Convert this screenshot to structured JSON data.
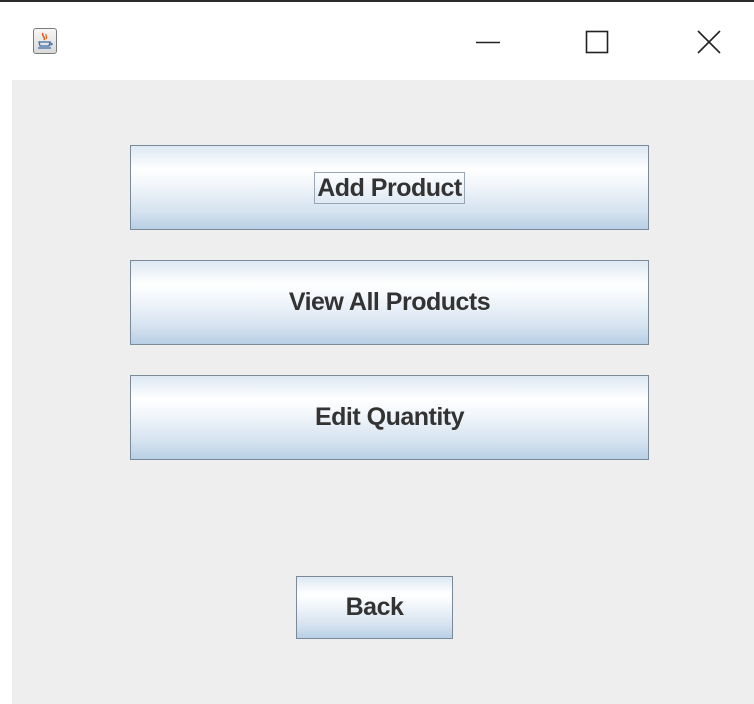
{
  "window": {
    "icon": "java-cup-icon",
    "controls": {
      "minimize": "minimize-icon",
      "maximize": "maximize-icon",
      "close": "close-icon"
    }
  },
  "buttons": {
    "add_product": "Add Product",
    "view_all_products": "View All Products",
    "edit_quantity": "Edit Quantity",
    "back": "Back"
  },
  "colors": {
    "content_background": "#eeeeee",
    "button_border": "#7a8a99",
    "button_text": "#333333"
  }
}
